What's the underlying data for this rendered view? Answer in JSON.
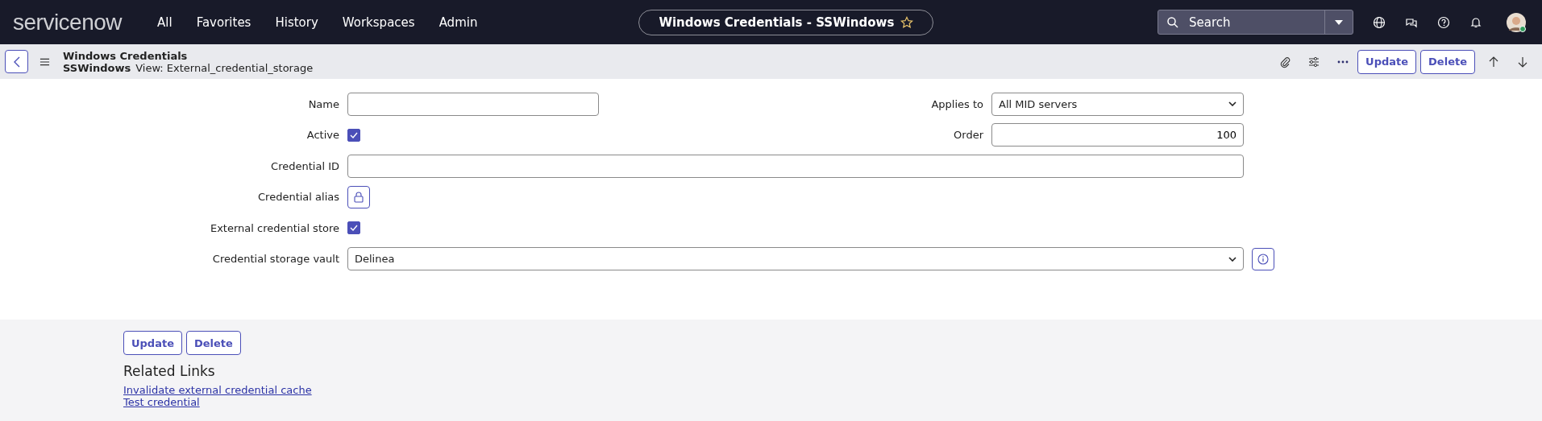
{
  "topnav": {
    "logo": "servicenow",
    "menu": [
      {
        "label": "All"
      },
      {
        "label": "Favorites"
      },
      {
        "label": "History"
      },
      {
        "label": "Workspaces"
      },
      {
        "label": "Admin"
      }
    ],
    "record_title": "Windows Credentials - SSWindows",
    "favorite": false,
    "search": {
      "placeholder": "Search"
    }
  },
  "header": {
    "table": "Windows Credentials",
    "record": "SSWindows",
    "view": "View: External_credential_storage",
    "buttons": [
      "Update",
      "Delete"
    ]
  },
  "form": {
    "left": [
      {
        "kind": "text",
        "label": "Name"
      },
      {
        "kind": "checkbox",
        "label": "Active",
        "checked": true
      },
      {
        "kind": "wide",
        "label": "Credential ID"
      },
      {
        "kind": "lock",
        "label": "Credential alias"
      },
      {
        "kind": "checkbox",
        "label": "External credential store",
        "checked": true
      },
      {
        "kind": "select_info",
        "label": "Credential storage vault",
        "value": "Delinea"
      }
    ],
    "right": [
      {
        "kind": "select",
        "label": "Applies to",
        "value": "All MID servers"
      },
      {
        "kind": "number",
        "label": "Order",
        "value": "100"
      }
    ]
  },
  "footer": {
    "buttons": [
      "Update",
      "Delete"
    ],
    "related_title": "Related Links",
    "links": [
      "Invalidate external credential cache",
      "Test credential"
    ]
  }
}
